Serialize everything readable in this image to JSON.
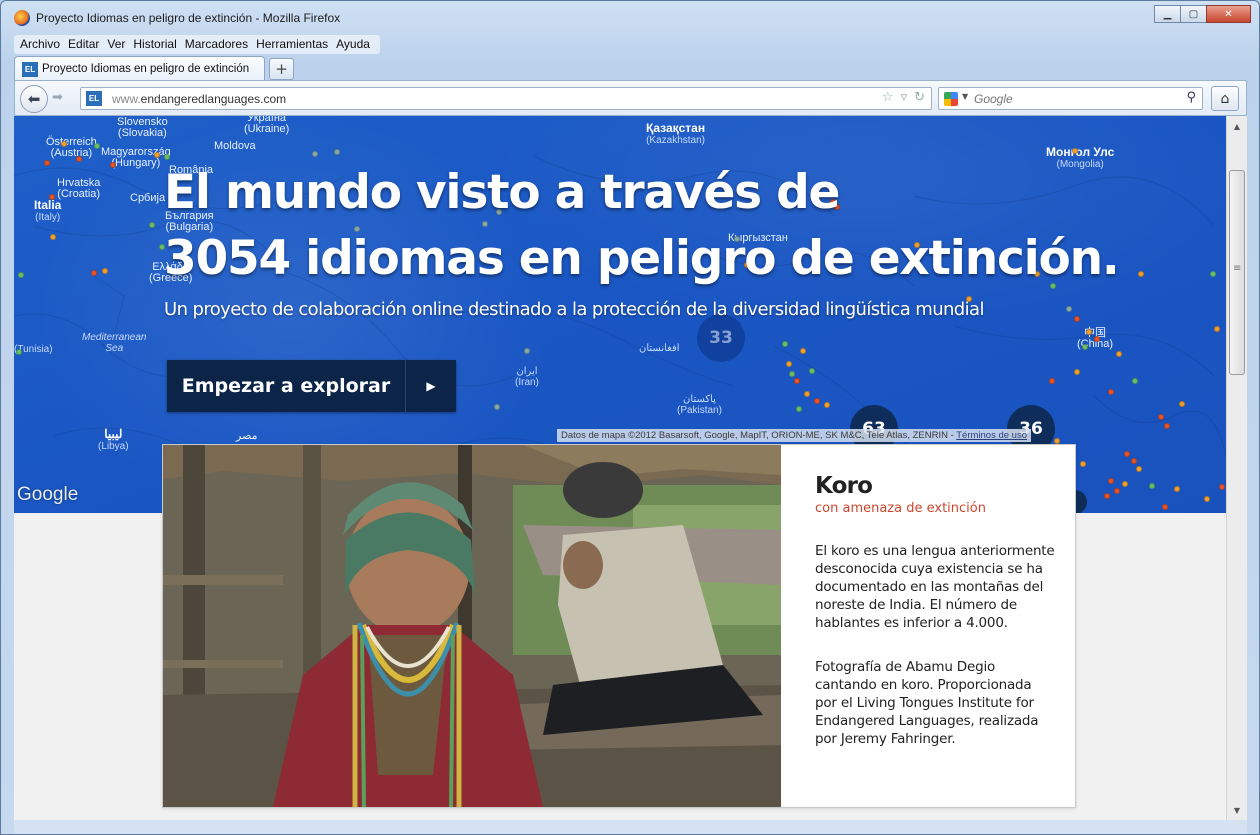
{
  "window": {
    "title": "Proyecto Idiomas en peligro de extinción - Mozilla Firefox",
    "controls": [
      "minimize-icon",
      "maximize-icon",
      "close-icon"
    ]
  },
  "menu": [
    "Archivo",
    "Editar",
    "Ver",
    "Historial",
    "Marcadores",
    "Herramientas",
    "Ayuda"
  ],
  "tab": {
    "favicon": "EL",
    "label": "Proyecto Idiomas en peligro de extinción",
    "new_tab": "+"
  },
  "nav": {
    "url_prefix": "www.",
    "url_domain": "endangeredlanguages.com",
    "search_placeholder": "Google"
  },
  "hero": {
    "title_line1": "El mundo visto a través de",
    "title_line2": "3054 idiomas en peligro de extinción.",
    "subtitle": "Un proyecto de colaboración online destinado a la protección de la diversidad lingüística mundial",
    "button_label": "Empezar a explorar"
  },
  "map": {
    "attribution": "Datos de mapa ©2012 Basarsoft, Google, MapIT, ORION-ME, SK M&C, Tele Atlas, ZENRIN -",
    "terms": "Términos de uso",
    "google_logo": "Google",
    "clusters": [
      "33",
      "63",
      "36"
    ],
    "labels": {
      "slovensko": "Slovensko",
      "slovensko_en": "(Slovakia)",
      "ukraine": "Україна",
      "ukraine_en": "(Ukraine)",
      "oesterreich": "Österreich",
      "oesterreich_en": "(Austria)",
      "hungary": "Magyarország",
      "hungary_en": "(Hungary)",
      "moldova": "Moldova",
      "romania": "România",
      "hrvatska": "Hrvatska",
      "hrvatska_en": "(Croatia)",
      "italia": "Italia",
      "italia_en": "(Italy)",
      "srbija": "Србија",
      "bulgaria": "България",
      "bulgaria_en": "(Bulgaria)",
      "greece": "Ελλάδα",
      "greece_en": "(Greece)",
      "mediterranean": "Mediterranean",
      "mediterranean_sea": "Sea",
      "libya": "ليبيا",
      "libya_en": "(Libya)",
      "egypt": "مصر",
      "kazakhstan": "Қазақстан",
      "kazakhstan_en": "(Kazakhstan)",
      "mongolia": "Монгол Улс",
      "mongolia_en": "(Mongolia)",
      "kyrgyzstan": "Кыргызстан",
      "afghanistan": "افغانستان",
      "iran": "ایران",
      "iran_en": "(Iran)",
      "pakistan": "پاکستان",
      "pakistan_en": "(Pakistan)",
      "china": "中国",
      "china_en": "(China)",
      "tunisia": "(Tunisia)"
    }
  },
  "featured": {
    "language": "Koro",
    "status": "con amenaza de extinción",
    "description": "El koro es una lengua anteriormente desconocida cuya existencia se ha documentado en las montañas del noreste de India. El número de hablantes es inferior a 4.000.",
    "credit": "Fotografía de Abamu Degio cantando en koro. Proporcionada por el Living Tongues Institute for Endangered Languages, realizada por Jeremy Fahringer."
  },
  "colors": {
    "map_blue": "#1a57c4",
    "button_navy": "#0b2447",
    "status_red": "#c9482f"
  }
}
